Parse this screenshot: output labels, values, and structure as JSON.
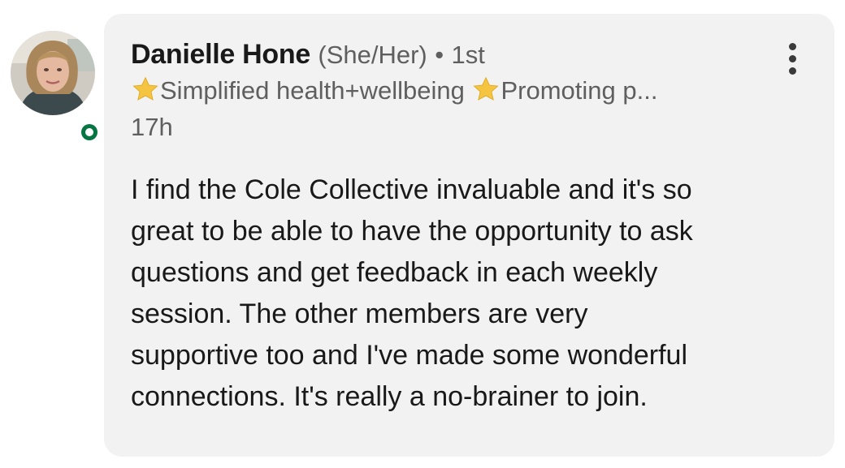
{
  "author": {
    "name": "Danielle Hone",
    "pronouns": "(She/Her)",
    "separator": "•",
    "degree": "1st",
    "headline_parts": [
      "Simplified health+wellbeing",
      "Promoting p..."
    ],
    "timestamp": "17h",
    "presence": "online"
  },
  "comment": {
    "lines": [
      "I find the Cole Collective invaluable and it's so",
      "great to be able to have the opportunity to ask",
      "questions and get feedback in each weekly",
      "session. The other members are very",
      "supportive too and I've made some wonderful",
      "connections. It's really a no-brainer to join."
    ]
  },
  "colors": {
    "bubble_bg": "#f2f2f2",
    "presence_green": "#057642",
    "star_yellow": "#f5c542",
    "secondary_text": "#5f5f5f"
  },
  "icons": [
    "avatar",
    "presence-indicator-icon",
    "star-icon",
    "more-options-icon"
  ]
}
